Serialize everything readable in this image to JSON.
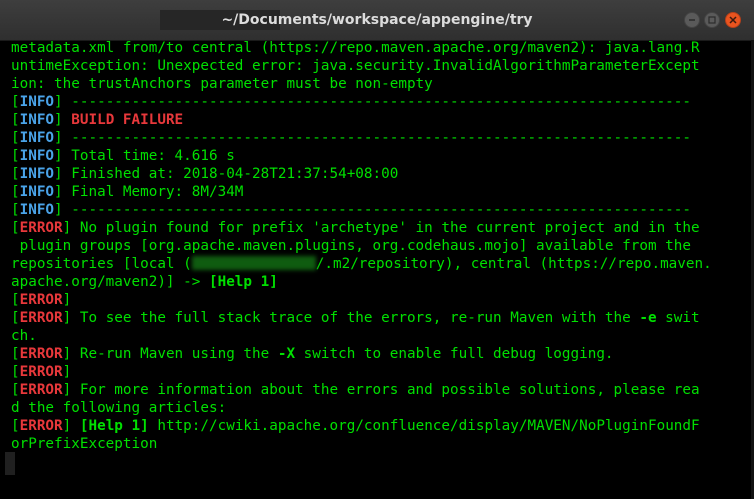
{
  "window": {
    "title": "~/Documents/workspace/appengine/try"
  },
  "terminal": {
    "lines": [
      {
        "segments": [
          {
            "t": "metadata.xml from/to central (https://repo.maven.apache.org/maven2): java.lang.R",
            "s": "plain"
          }
        ]
      },
      {
        "segments": [
          {
            "t": "untimeException: Unexpected error: java.security.InvalidAlgorithmParameterExcept",
            "s": "plain"
          }
        ]
      },
      {
        "segments": [
          {
            "t": "ion: the trustAnchors parameter must be non-empty",
            "s": "plain"
          }
        ]
      },
      {
        "segments": [
          {
            "t": "[",
            "s": "bracket"
          },
          {
            "t": "INFO",
            "s": "info"
          },
          {
            "t": "] ------------------------------------------------------------------------",
            "s": "plain"
          }
        ]
      },
      {
        "segments": [
          {
            "t": "[",
            "s": "bracket"
          },
          {
            "t": "INFO",
            "s": "info"
          },
          {
            "t": "] ",
            "s": "plain"
          },
          {
            "t": "BUILD FAILURE",
            "s": "failure"
          }
        ]
      },
      {
        "segments": [
          {
            "t": "[",
            "s": "bracket"
          },
          {
            "t": "INFO",
            "s": "info"
          },
          {
            "t": "] ------------------------------------------------------------------------",
            "s": "plain"
          }
        ]
      },
      {
        "segments": [
          {
            "t": "[",
            "s": "bracket"
          },
          {
            "t": "INFO",
            "s": "info"
          },
          {
            "t": "] Total time: 4.616 s",
            "s": "plain"
          }
        ]
      },
      {
        "segments": [
          {
            "t": "[",
            "s": "bracket"
          },
          {
            "t": "INFO",
            "s": "info"
          },
          {
            "t": "] Finished at: 2018-04-28T21:37:54+08:00",
            "s": "plain"
          }
        ]
      },
      {
        "segments": [
          {
            "t": "[",
            "s": "bracket"
          },
          {
            "t": "INFO",
            "s": "info"
          },
          {
            "t": "] Final Memory: 8M/34M",
            "s": "plain"
          }
        ]
      },
      {
        "segments": [
          {
            "t": "[",
            "s": "bracket"
          },
          {
            "t": "INFO",
            "s": "info"
          },
          {
            "t": "] ------------------------------------------------------------------------",
            "s": "plain"
          }
        ]
      },
      {
        "segments": [
          {
            "t": "[",
            "s": "bracket"
          },
          {
            "t": "ERROR",
            "s": "error"
          },
          {
            "t": "] No plugin found for prefix 'archetype' in the current project and in the",
            "s": "plain"
          }
        ]
      },
      {
        "segments": [
          {
            "t": " plugin groups [org.apache.maven.plugins, org.codehaus.mojo] available from the",
            "s": "plain"
          }
        ]
      },
      {
        "segments": [
          {
            "t": "repositories [local (",
            "s": "plain"
          },
          {
            "t": "",
            "s": "blur"
          },
          {
            "t": "/.m2/repository), central (https://repo.maven.",
            "s": "plain"
          }
        ]
      },
      {
        "segments": [
          {
            "t": "apache.org/maven2)] -> ",
            "s": "plain"
          },
          {
            "t": "[Help 1]",
            "s": "bold"
          }
        ]
      },
      {
        "segments": [
          {
            "t": "[",
            "s": "bracket"
          },
          {
            "t": "ERROR",
            "s": "error"
          },
          {
            "t": "]",
            "s": "plain"
          }
        ]
      },
      {
        "segments": [
          {
            "t": "[",
            "s": "bracket"
          },
          {
            "t": "ERROR",
            "s": "error"
          },
          {
            "t": "] To see the full stack trace of the errors, re-run Maven with the ",
            "s": "plain"
          },
          {
            "t": "-e",
            "s": "bold"
          },
          {
            "t": " swit",
            "s": "plain"
          }
        ]
      },
      {
        "segments": [
          {
            "t": "ch.",
            "s": "plain"
          }
        ]
      },
      {
        "segments": [
          {
            "t": "[",
            "s": "bracket"
          },
          {
            "t": "ERROR",
            "s": "error"
          },
          {
            "t": "] Re-run Maven using the ",
            "s": "plain"
          },
          {
            "t": "-X",
            "s": "bold"
          },
          {
            "t": " switch to enable full debug logging.",
            "s": "plain"
          }
        ]
      },
      {
        "segments": [
          {
            "t": "[",
            "s": "bracket"
          },
          {
            "t": "ERROR",
            "s": "error"
          },
          {
            "t": "]",
            "s": "plain"
          }
        ]
      },
      {
        "segments": [
          {
            "t": "[",
            "s": "bracket"
          },
          {
            "t": "ERROR",
            "s": "error"
          },
          {
            "t": "] For more information about the errors and possible solutions, please rea",
            "s": "plain"
          }
        ]
      },
      {
        "segments": [
          {
            "t": "d the following articles:",
            "s": "plain"
          }
        ]
      },
      {
        "segments": [
          {
            "t": "[",
            "s": "bracket"
          },
          {
            "t": "ERROR",
            "s": "error"
          },
          {
            "t": "] ",
            "s": "plain"
          },
          {
            "t": "[Help 1]",
            "s": "bold"
          },
          {
            "t": " http://cwiki.apache.org/confluence/display/MAVEN/NoPluginFoundF",
            "s": "plain"
          }
        ]
      },
      {
        "segments": [
          {
            "t": "orPrefixException",
            "s": "plain"
          }
        ]
      }
    ]
  },
  "colors": {
    "text": "#00e000",
    "info": "#4aa3e8",
    "error": "#e8383b",
    "close_button": "#e9541f",
    "background": "#000000"
  },
  "icons": {
    "minimize": "minimize-icon",
    "maximize": "maximize-icon",
    "close": "close-icon"
  }
}
